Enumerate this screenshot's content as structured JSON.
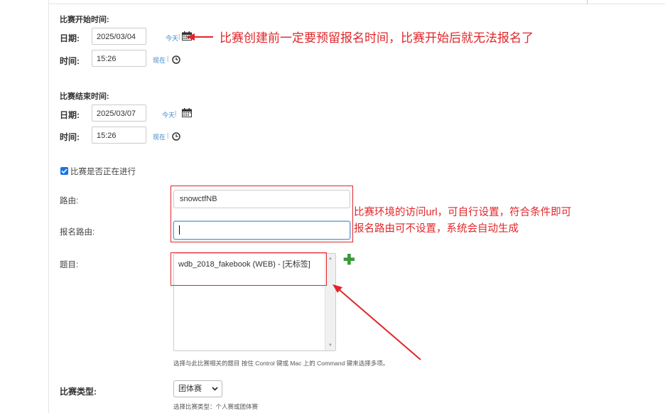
{
  "start": {
    "title": "比赛开始时间:",
    "date_label": "日期:",
    "date_value": "2025/03/04",
    "today_link": "今天",
    "sep": "|",
    "time_label": "时间:",
    "time_value": "15:26",
    "now_link": "现在",
    "annotation": "比赛创建前一定要预留报名时间，比赛开始后就无法报名了"
  },
  "end": {
    "title": "比赛结束时间:",
    "date_label": "日期:",
    "date_value": "2025/03/07",
    "today_link": "今天",
    "sep": "|",
    "time_label": "时间:",
    "time_value": "15:26",
    "now_link": "现在"
  },
  "ongoing": {
    "label": "比赛是否正在进行",
    "checked": true
  },
  "route": {
    "label": "路由:",
    "value": "snowctfNB"
  },
  "signup_route": {
    "label": "报名路由:",
    "value": ""
  },
  "route_annotation": {
    "line1": "比赛环境的访问url，可自行设置，符合条件即可",
    "line2": "报名路由可不设置，系统会自动生成"
  },
  "problems": {
    "label": "题目:",
    "options": [
      "wdb_2018_fakebook (WEB) - [无标签]"
    ],
    "add_icon": "plus-icon",
    "help": "选择与此比赛相关的题目 按住 Control 键或 Mac 上的 Command 键来选择多项。"
  },
  "contest_type": {
    "label": "比赛类型:",
    "selected": "团体赛",
    "help": "选择比赛类型：个人赛或团体赛"
  },
  "colors": {
    "annotation_red": "#e0262a",
    "link_blue": "#3a87c8",
    "add_green": "#3a9a3a",
    "checkbox_blue": "#1a73e8"
  }
}
